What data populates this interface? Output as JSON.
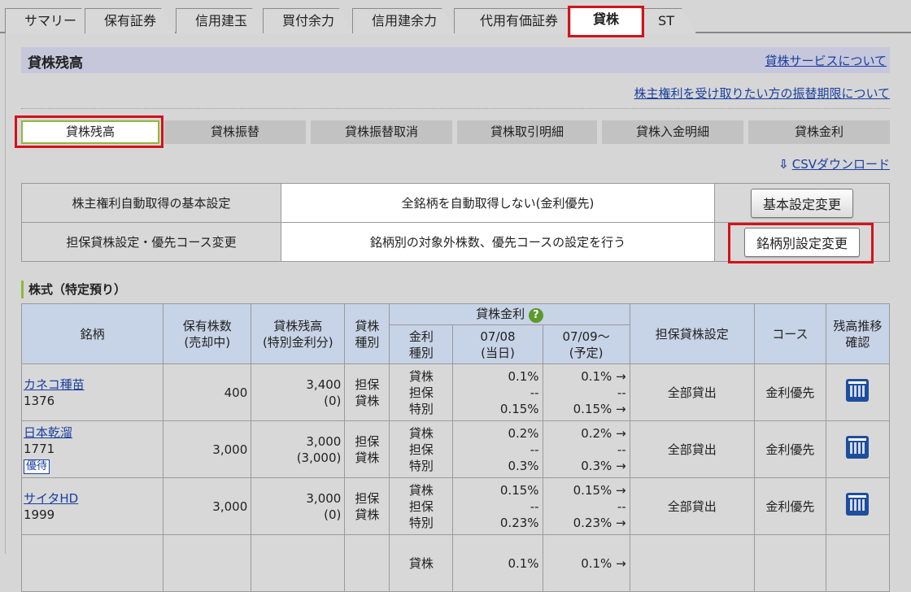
{
  "tabs": [
    {
      "label": "サマリー"
    },
    {
      "label": "保有証券"
    },
    {
      "label": "信用建玉"
    },
    {
      "label": "買付余力"
    },
    {
      "label": "信用建余力"
    },
    {
      "label": "代用有価証券"
    },
    {
      "label": "貸株"
    },
    {
      "label": "ST"
    }
  ],
  "section": {
    "title": "貸株残高",
    "service_link": "貸株サービスについて",
    "holder_link": "株主権利を受け取りたい方の振替期限について"
  },
  "subtabs": [
    {
      "label": "貸株残高"
    },
    {
      "label": "貸株振替"
    },
    {
      "label": "貸株振替取消"
    },
    {
      "label": "貸株取引明細"
    },
    {
      "label": "貸株入金明細"
    },
    {
      "label": "貸株金利"
    }
  ],
  "csv_link": "CSVダウンロード",
  "settings": [
    {
      "label": "株主権利自動取得の基本設定",
      "value": "全銘柄を自動取得しない(金利優先)",
      "button": "基本設定変更"
    },
    {
      "label": "担保貸株設定・優先コース変更",
      "value": "銘柄別の対象外株数、優先コースの設定を行う",
      "button": "銘柄別設定変更"
    }
  ],
  "stock_section": "株式（特定預り）",
  "table": {
    "headers": {
      "name": "銘柄",
      "held": "保有株数",
      "held_sub": "(売却中)",
      "balance": "貸株残高",
      "balance_sub": "(特別金利分)",
      "type": "貸株",
      "type_sub": "種別",
      "rate": "貸株金利",
      "rate_type": "金利",
      "rate_type_sub": "種別",
      "d1": "07/08",
      "d1_sub": "(当日)",
      "d2": "07/09～",
      "d2_sub": "(予定)",
      "collateral": "担保貸株設定",
      "course": "コース",
      "trend": "残高推移",
      "trend_sub": "確認"
    },
    "rows": [
      {
        "name": "カネコ種苗",
        "code": "1376",
        "tag": "",
        "held": "400",
        "balance": "3,400",
        "balance_sub": "(0)",
        "type1": "担保",
        "type2": "貸株",
        "rt1": "貸株",
        "rt2": "担保",
        "rt3": "特別",
        "a1": "0.1%",
        "a2": "--",
        "a3": "0.15%",
        "b1": "0.1% →",
        "b2": "--",
        "b3": "0.15% →",
        "collateral": "全部貸出",
        "course": "金利優先"
      },
      {
        "name": "日本乾溜",
        "code": "1771",
        "tag": "優待",
        "held": "3,000",
        "balance": "3,000",
        "balance_sub": "(3,000)",
        "type1": "担保",
        "type2": "貸株",
        "rt1": "貸株",
        "rt2": "担保",
        "rt3": "特別",
        "a1": "0.2%",
        "a2": "--",
        "a3": "0.3%",
        "b1": "0.2% →",
        "b2": "--",
        "b3": "0.3% →",
        "collateral": "全部貸出",
        "course": "金利優先"
      },
      {
        "name": "サイタHD",
        "code": "1999",
        "tag": "",
        "held": "3,000",
        "balance": "3,000",
        "balance_sub": "(0)",
        "type1": "担保",
        "type2": "貸株",
        "rt1": "貸株",
        "rt2": "担保",
        "rt3": "特別",
        "a1": "0.15%",
        "a2": "--",
        "a3": "0.23%",
        "b1": "0.15% →",
        "b2": "--",
        "b3": "0.23% →",
        "collateral": "全部貸出",
        "course": "金利優先"
      },
      {
        "name": "",
        "code": "",
        "tag": "",
        "held": "",
        "balance": "",
        "balance_sub": "",
        "type1": "",
        "type2": "",
        "rt1": "貸株",
        "rt2": "",
        "rt3": "",
        "a1": "0.1%",
        "a2": "",
        "a3": "",
        "b1": "0.1% →",
        "b2": "",
        "b3": "",
        "collateral": "",
        "course": ""
      }
    ]
  }
}
